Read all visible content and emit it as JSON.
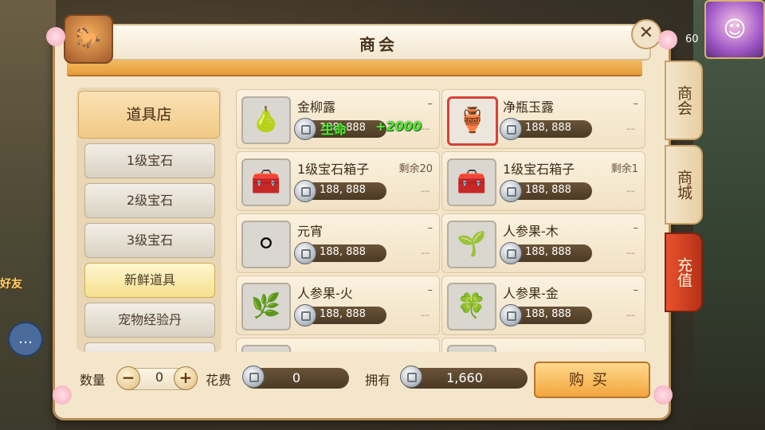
{
  "window": {
    "title": "商会",
    "close_label": "✕"
  },
  "side_tabs": [
    "商会",
    "商城",
    "充值"
  ],
  "categories": [
    {
      "label": "道具店"
    },
    {
      "label": "1级宝石"
    },
    {
      "label": "2级宝石"
    },
    {
      "label": "3级宝石"
    },
    {
      "label": "新鲜道具"
    },
    {
      "label": "宠物经验丹"
    }
  ],
  "items": [
    {
      "name": "金柳露",
      "stock": "–",
      "price": "188, 888",
      "extra": "––",
      "icon": "green-gourd-icon"
    },
    {
      "name": "净瓶玉露",
      "stock": "–",
      "price": "188, 888",
      "extra": "––",
      "icon": "jade-vase-icon"
    },
    {
      "name": "1级宝石箱子",
      "stock": "剩余20",
      "price": "188, 888",
      "extra": "––",
      "icon": "treasure-chest-icon"
    },
    {
      "name": "1级宝石箱子",
      "stock": "剩余1",
      "price": "188, 888",
      "extra": "––",
      "icon": "treasure-chest-icon"
    },
    {
      "name": "元宵",
      "stock": "–",
      "price": "188, 888",
      "extra": "––",
      "icon": "rice-ball-icon"
    },
    {
      "name": "人参果-木",
      "stock": "–",
      "price": "188, 888",
      "extra": "––",
      "icon": "ginseng-fruit-wood-icon"
    },
    {
      "name": "人参果-火",
      "stock": "–",
      "price": "188, 888",
      "extra": "––",
      "icon": "ginseng-fruit-fire-icon"
    },
    {
      "name": "人参果-金",
      "stock": "–",
      "price": "188, 888",
      "extra": "––",
      "icon": "ginseng-fruit-metal-icon"
    }
  ],
  "buff_popup": {
    "label": "生命",
    "value": "+2000"
  },
  "bottom": {
    "quantity_label": "数量",
    "quantity_value": "0",
    "minus": "−",
    "plus": "+",
    "cost_label": "花费",
    "cost_value": "0",
    "owned_label": "拥有",
    "owned_value": "1,660",
    "buy_label": "购买"
  },
  "hud": {
    "level": "60",
    "friend_label": "好友"
  }
}
